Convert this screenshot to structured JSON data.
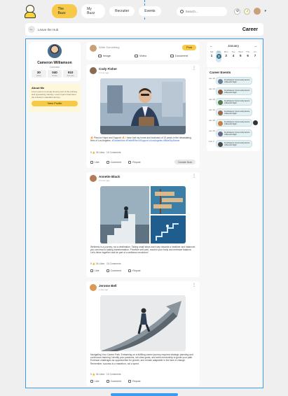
{
  "nav": {
    "tabs": [
      {
        "label": "The Buzz"
      },
      {
        "label": "My Buzz"
      },
      {
        "label": "Recruiter"
      },
      {
        "label": "Events"
      }
    ],
    "search_placeholder": "Search..."
  },
  "breadcrumb": {
    "label": "Leave the Hub",
    "title": "Career"
  },
  "profile": {
    "name": "Cameron Williamson",
    "location": "Colorado",
    "stats": [
      {
        "value": "30",
        "label": "Likes"
      },
      {
        "value": "040",
        "label": "Posts"
      },
      {
        "value": "910",
        "label": "Friends"
      }
    ],
    "about_title": "About Me",
    "about_text": "Lorem ipsum is simply dummy text of the printing and typesetting industry. Lorem ipsum has been the industry's standard dummy.",
    "view_profile": "View Profile"
  },
  "composer": {
    "placeholder": "Write Something",
    "post_label": "Post",
    "actions": [
      "Image",
      "Video",
      "Document"
    ]
  },
  "posts": [
    {
      "author": "Cody Fisher",
      "time": "1 hour ago",
      "text": "🔥 Plea for Hope and Support 🔥 I have lost my home and business of 10 years in the devastating fires of Los Angeles.",
      "tags": "#DonateNow #ReliefEffort #Support #LosAngeles #BlueSkyDance",
      "stats": "5 👍 34 Likes · 10 Comments",
      "actions": [
        "Like",
        "Comment",
        "Repost"
      ],
      "donate": "Donate Now"
    },
    {
      "author": "Annette Black",
      "time": "2 hours ago",
      "text": "Wellness is a journey, not a destination. Taking small steps each day towards a healthier and balanced you can lead to lasting transformation. Prioritize self-care, nourish your body and embrace balance. Let's thrive together and be part of a wellness revolution!",
      "stats": "5 👍 34 Likes · 10 Comments",
      "actions": [
        "Like",
        "Comment",
        "Repost"
      ]
    },
    {
      "author": "Jerome Bell",
      "time": "1 day ago",
      "text": "Navigating Your Career Path. Embarking on a fulfilling career journey requires strategic planning and continuous learning. Identify your passions, set clear goals, and seek mentorship to guide your path. Embrace challenges as opportunities for growth, and remain adaptable in the face of change. Remember, success is a marathon, not a sprint.",
      "stats": "5 👍 34 Likes · 10 Comments",
      "actions": [
        "Like",
        "Comment",
        "Repost"
      ]
    }
  ],
  "calendar": {
    "month": "January",
    "prev": "←",
    "next": "→",
    "days": [
      {
        "dow": "Sat",
        "num": "1"
      },
      {
        "dow": "Sun",
        "num": "2"
      },
      {
        "dow": "Mon",
        "num": "3"
      },
      {
        "dow": "Tue",
        "num": "4"
      },
      {
        "dow": "Wed",
        "num": "5"
      },
      {
        "dow": "Thu",
        "num": "6"
      },
      {
        "dow": "Fri",
        "num": "7"
      }
    ]
  },
  "events": {
    "title": "Career Events",
    "items": [
      {
        "date": "Jan 18",
        "text": "Fundraisers Community Event · A Benefit Night"
      },
      {
        "date": "Jan 21",
        "text": "Fundraisers Community Event · A Benefit Night"
      },
      {
        "date": "Jan 24",
        "text": "Fundraisers Community Event · A Benefit Night"
      },
      {
        "date": "Jan 26",
        "text": "Fundraisers Community Event · A Benefit Night"
      },
      {
        "date": "Jan 28",
        "text": "Fundraisers Community Event · A Benefit Night"
      },
      {
        "date": "Jan 30",
        "text": "Fundraisers Community Event · A Benefit Night"
      },
      {
        "date": "Feb 2",
        "text": "Fundraisers Community Event · A Benefit Night"
      }
    ]
  }
}
